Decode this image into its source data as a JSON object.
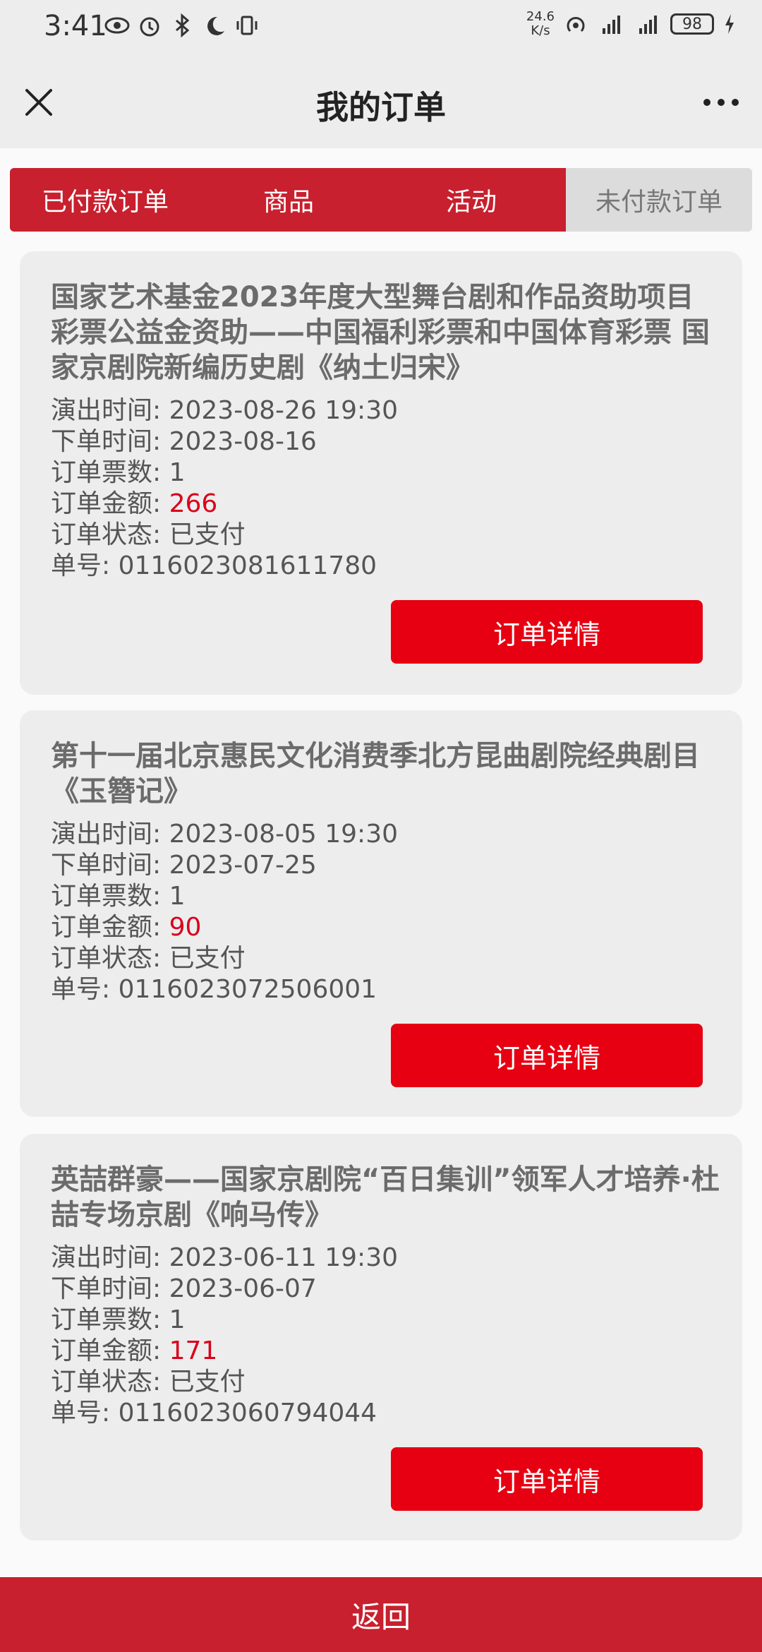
{
  "status_bar": {
    "time": "3:41",
    "speed_value": "24.6",
    "speed_unit": "K/s",
    "battery": "98"
  },
  "nav": {
    "title": "我的订单"
  },
  "tabs": [
    {
      "label": "已付款订单",
      "active": true
    },
    {
      "label": "商品",
      "active": true
    },
    {
      "label": "活动",
      "active": true
    },
    {
      "label": "未付款订单",
      "active": false
    }
  ],
  "field_labels": {
    "show_time": "演出时间:",
    "order_time": "下单时间:",
    "ticket_count": "订单票数:",
    "amount": "订单金额:",
    "status": "订单状态:",
    "order_no": "单号:"
  },
  "detail_button_label": "订单详情",
  "orders": [
    {
      "title": "国家艺术基金2023年度大型舞台剧和作品资助项目 彩票公益金资助——中国福利彩票和中国体育彩票 国家京剧院新编历史剧《纳土归宋》",
      "show_time": "2023-08-26 19:30",
      "order_time": "2023-08-16",
      "ticket_count": "1",
      "amount": "266",
      "status": "已支付",
      "order_no": "0116023081611780"
    },
    {
      "title": "第十一届北京惠民文化消费季北方昆曲剧院经典剧目《玉簪记》",
      "show_time": "2023-08-05 19:30",
      "order_time": "2023-07-25",
      "ticket_count": "1",
      "amount": "90",
      "status": "已支付",
      "order_no": "0116023072506001"
    },
    {
      "title": "英喆群豪——国家京剧院“百日集训”领军人才培养·杜喆专场京剧《响马传》",
      "show_time": "2023-06-11 19:30",
      "order_time": "2023-06-07",
      "ticket_count": "1",
      "amount": "171",
      "status": "已支付",
      "order_no": "0116023060794044"
    }
  ],
  "bottom": {
    "back_label": "返回"
  }
}
